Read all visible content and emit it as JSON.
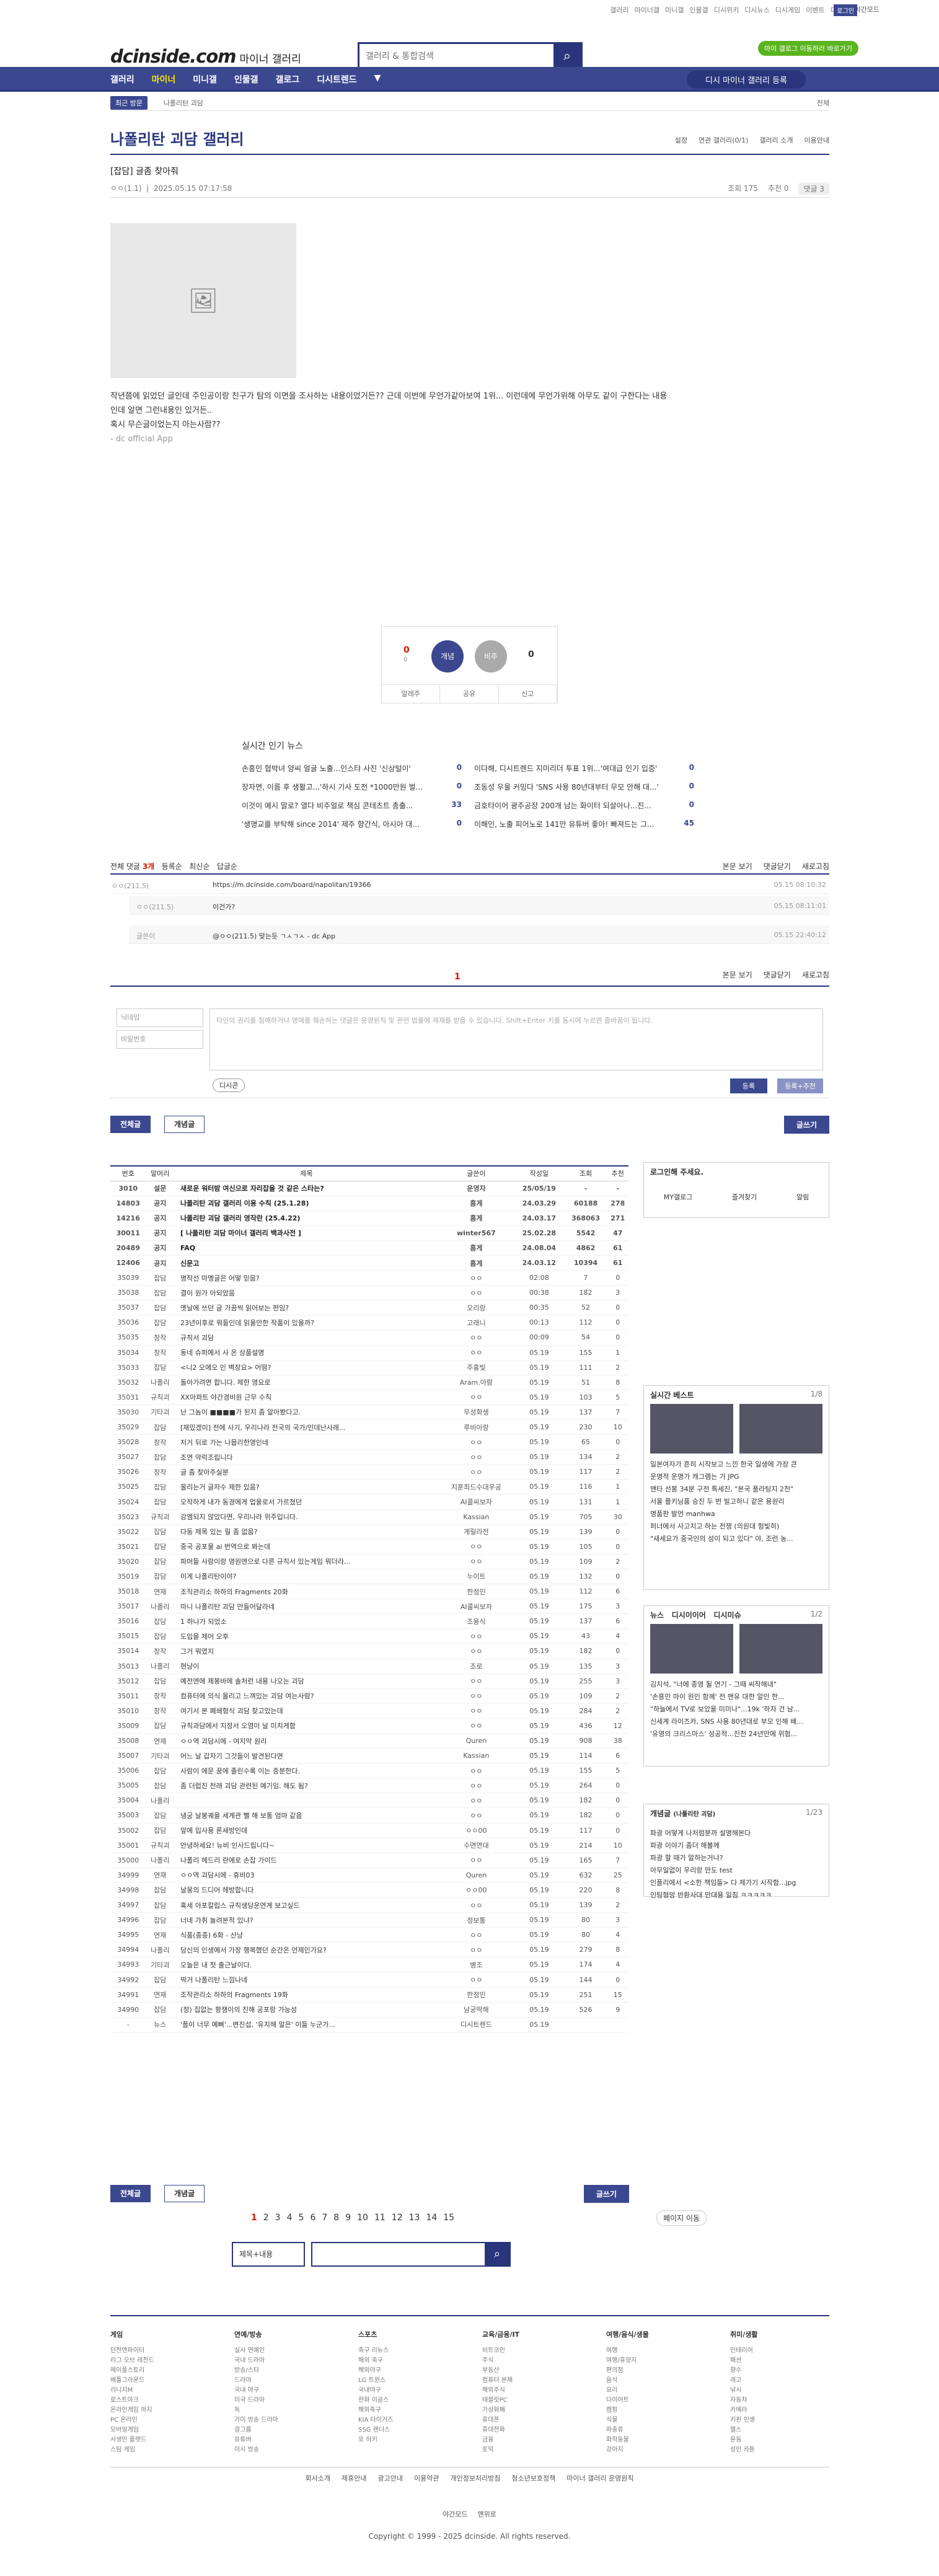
{
  "top": {
    "links": [
      "갤러리",
      "마이너갤",
      "미니갤",
      "인물갤",
      "디시위키",
      "디시뉴스",
      "디시게임",
      "이벤트",
      "디시콘"
    ],
    "login": "로그인",
    "night": "야간모드",
    "promo": "마이 갤로그 이동하러 바로가기"
  },
  "logo": {
    "main": "dcinside.com",
    "sub": "마이너 갤러리"
  },
  "search": {
    "placeholder": "갤러리 & 통합검색"
  },
  "gnb": {
    "items": [
      "갤러리",
      "마이너",
      "미니갤",
      "인물갤",
      "갤로그",
      "디시트렌드"
    ],
    "gal_btn": "디시 마이너 갤러리 등록"
  },
  "sub": {
    "pill": "최근 방문",
    "crumb": "나폴리탄 괴담",
    "right": "전체"
  },
  "gallery": {
    "title": "나폴리탄 괴담 갤러리",
    "opts": [
      "설정",
      "연관 갤러리(0/1)",
      "갤러리 소개",
      "이용안내"
    ]
  },
  "post": {
    "title": "[잡담] 글좀 찾아줘",
    "author": "ㅇㅇ(1.1)",
    "date": "2025.05.15 07:17:58",
    "views": "조회 175",
    "rec": "추천 0",
    "reply": "댓글 3",
    "text": "작년쯤에 읽었던 글인데 주인공이랑 친구가 탐의 이면을 조사하는 내용이었거든?? 근데 이번에 무언가같아보여 1위... 이런데에 무언가위해 아무도 같이 구한다는 내용인데 알면 그런내용인 있거든..",
    "text2": "혹시 무슨글이었는지 아는사람??",
    "app": "- dc official App"
  },
  "vote": {
    "up_count": "0",
    "up_sub": "0",
    "up_label": "개념",
    "down_label": "비추",
    "down_count": "0",
    "btn1": "알레주",
    "btn2": "공유",
    "btn3": "신고"
  },
  "popular": {
    "title": "실시간 인기 뉴스",
    "items": [
      {
        "t": "손흥민 협박녀 양씨 얼굴 노출...인스타 사진 '신상털이'",
        "c": "0"
      },
      {
        "t": "이다해, 디시트렌드 지미리더 투표 1위...'여대급 인기 입증'",
        "c": "0"
      },
      {
        "t": "장자연, 이름 후 생활고...'하시 기사 도전 *1000만원 벌...",
        "c": "0"
      },
      {
        "t": "조동성 우울 커밍다 'SNS 사용 80년대부터 무모 안해 대...'",
        "c": "0"
      },
      {
        "t": "이것이 예시 말로? 열다 비주얼로 책심 콘테츠트 총출...",
        "c": "33"
      },
      {
        "t": "금호타이어 광주공장 200개 남는 화이터 되살아나...진...",
        "c": "0"
      },
      {
        "t": "'생명교를 부탁해 since 2014' 제주 향간식, 아시아 대...",
        "c": "0"
      },
      {
        "t": "이해인, 노출 피어노로 141만 유튜버 좋아! 빠져드는 그...",
        "c": "45"
      }
    ]
  },
  "comments": {
    "head": "전체 댓글",
    "count": "3개",
    "sort": [
      "등록순",
      "최신순",
      "답글순"
    ],
    "right": [
      "본문 보기",
      "댓글닫기",
      "새로고침"
    ],
    "rows": [
      {
        "w": "ㅇㅇ(211.5)",
        "t": "https://m.dcinside.com/board/napolitan/19366",
        "d": "05.15 08:10:32"
      },
      {
        "w": "ㅇㅇ(211.5)",
        "t": "이건가?",
        "d": "05.15 08:11:01"
      },
      {
        "w": "글쓴이",
        "t": "@ㅇㅇ(211.5) 맞는듯 ㄱㅅㄱㅅ - dc App",
        "d": "05.15 22:40:12"
      }
    ],
    "page": "1"
  },
  "write": {
    "nick": "닉네임",
    "pass": "비밀번호",
    "placeholder": "타인의 권리를 침해하거나 명예를 훼손하는 댓글은 운영원칙 및 관련 법률에 제재를 받을 수 있습니다. Shift+Enter 키를 동시에 누르면 줄바꿈이 됩니다.",
    "dccon": "디시콘",
    "reg": "등록",
    "reg2": "등록+추천"
  },
  "tabs": {
    "all": "전체글",
    "best": "개념글",
    "write": "글쓰기"
  },
  "list": {
    "headers": [
      "번호",
      "말머리",
      "제목",
      "글쓴이",
      "작성일",
      "조회",
      "추천"
    ],
    "rows": [
      [
        "3010",
        "설문",
        "새로운 워터밤 여신으로 자리잡을 것 같은 스타는?",
        "운영자",
        "25/05/19",
        "-",
        "-",
        "n"
      ],
      [
        "14803",
        "공지",
        "나폴리탄 괴담 갤러리 이용 수칙 (25.1.28)",
        "흠게",
        "24.03.29",
        "60188",
        "278",
        "n"
      ],
      [
        "14216",
        "공지",
        "나폴리탄 괴담 갤러리 영작란 (25.4.22)",
        "흠게",
        "24.03.17",
        "368063",
        "271",
        "n"
      ],
      [
        "30011",
        "공지",
        "[ 나폴리탄 괴담 마이너 갤러리 백과사전 ]",
        "winter567",
        "25.02.28",
        "5542",
        "47",
        "n"
      ],
      [
        "20489",
        "공지",
        "FAQ",
        "흠게",
        "24.08.04",
        "4862",
        "61",
        "n"
      ],
      [
        "12406",
        "공지",
        "신문고",
        "흠게",
        "24.03.12",
        "10394",
        "61",
        "n"
      ],
      [
        "35039",
        "잡담",
        "명작선 마멩글은 어떻 믿믐?",
        "ㅇㅇ",
        "02:08",
        "7",
        "0",
        ""
      ],
      [
        "35038",
        "잡담",
        "결이 원가 아되았음",
        "ㅇㅇ",
        "00:38",
        "182",
        "3",
        ""
      ],
      [
        "35037",
        "잡담",
        "옛날에 쓰던 글 가끔씩 읽어보는 편임?",
        "오리랑",
        "00:35",
        "52",
        "0",
        ""
      ],
      [
        "35036",
        "잡담",
        "23년이후로 뭐들인데 읽을만한 작품이 있을까?",
        "고래니",
        "00:13",
        "112",
        "0",
        ""
      ],
      [
        "35035",
        "창작",
        "규칙서 괴담",
        "ㅇㅇ",
        "00:09",
        "54",
        "0",
        ""
      ],
      [
        "35034",
        "창작",
        "동네 슈퍼에서 사 온 상품설명",
        "ㅇㅇ",
        "05.19",
        "155",
        "1",
        ""
      ],
      [
        "35033",
        "잡담",
        "<니2 오에오 인 벽장요> 어떰?",
        "주홍빛",
        "05.19",
        "111",
        "2",
        ""
      ],
      [
        "35032",
        "나폴리",
        "돌아가려면 합니다. 제한 영요로",
        "Aram.아람",
        "05.19",
        "51",
        "8",
        ""
      ],
      [
        "35031",
        "규칙괴",
        "XX아파트 야간경비원 근무 수칙",
        "ㅇㅇ",
        "05.19",
        "103",
        "5",
        ""
      ],
      [
        "35030",
        "기타괴",
        "난 그놈이 ■■■■가 된지 좀 알아봤다고.",
        "무성화생",
        "05.19",
        "137",
        "7",
        ""
      ],
      [
        "35029",
        "잡담",
        "[재밌겠미] 전에 사기, 우리나라 전국의 국가/민데난사래...",
        "루비아랑",
        "05.19",
        "230",
        "10",
        ""
      ],
      [
        "35028",
        "창작",
        "저거 뒤로 가는 나뭅리한영인네",
        "ㅇㅇ",
        "05.19",
        "65",
        "0",
        ""
      ],
      [
        "35027",
        "잡담",
        "조연 약럭조립니다",
        "ㅇㅇ",
        "05.19",
        "134",
        "2",
        ""
      ],
      [
        "35026",
        "창작",
        "글 좀 찾아주실분",
        "ㅇㅇ",
        "05.19",
        "117",
        "2",
        ""
      ],
      [
        "35025",
        "잡담",
        "올리는거 글자수 제한 있음?",
        "지훈최드수대우공",
        "05.19",
        "116",
        "1",
        ""
      ],
      [
        "35024",
        "잡담",
        "오작하게 내가 동경에게 업을로서 가르쳤던",
        "AI콜씨보자",
        "05.19",
        "131",
        "1",
        ""
      ],
      [
        "35023",
        "규칙괴",
        "강엠되지 않았다면, 우리나라 위주입니다.",
        "Kassian",
        "05.19",
        "705",
        "30",
        ""
      ],
      [
        "35022",
        "잡담",
        "다동 제목 있는 릴 좀 없음?",
        "게릴라전",
        "05.19",
        "139",
        "0",
        ""
      ],
      [
        "35021",
        "잡담",
        "중국 공포물 ai 번역으로 봐는데",
        "ㅇㅇ",
        "05.19",
        "105",
        "0",
        ""
      ],
      [
        "35020",
        "잡담",
        "파머들 사람이랑 영원엔으로 다른 규칙서 있는게임 뭐더라...",
        "ㅇㅇ",
        "05.19",
        "109",
        "2",
        ""
      ],
      [
        "35019",
        "잡담",
        "이게 나폴리탄이야?",
        "누이트",
        "05.19",
        "132",
        "0",
        ""
      ],
      [
        "35018",
        "연재",
        "조직관리소 하하의 Fragments 20화",
        "한정민",
        "05.19",
        "112",
        "6",
        ""
      ],
      [
        "35017",
        "나폴리",
        "마니 나폴리탄 괴담 만들어달라네",
        "AI콜씨보자",
        "05.19",
        "175",
        "3",
        ""
      ],
      [
        "35016",
        "잡담",
        "1 하나가 되었소",
        "조용식",
        "05.19",
        "137",
        "6",
        ""
      ],
      [
        "35015",
        "잡담",
        "도입을 제어 오후",
        "ㅇㅇ",
        "05.19",
        "43",
        "4",
        ""
      ],
      [
        "35014",
        "창작",
        "그거 뭐였지",
        "ㅇㅇ",
        "05.19",
        "182",
        "0",
        ""
      ],
      [
        "35013",
        "나폴리",
        "현냥이",
        "조로",
        "05.19",
        "135",
        "3",
        ""
      ],
      [
        "35012",
        "잡담",
        "예전엔에 제봉바에 솔처런 내용 나오는 괴담",
        "ㅇㅇ",
        "05.19",
        "255",
        "3",
        ""
      ],
      [
        "35011",
        "창작",
        "컴퓨터에 의식 올리고 느껴있는 괴담 여는사람?",
        "ㅇㅇ",
        "05.19",
        "109",
        "2",
        ""
      ],
      [
        "35010",
        "창작",
        "여기서 본 폐쇄형식 괴담 찾고있는데",
        "ㅇㅇ",
        "05.19",
        "284",
        "2",
        ""
      ],
      [
        "35009",
        "잡담",
        "규칙과담에서 지정서 오염이 날 미치게함",
        "ㅇㅇ",
        "05.19",
        "436",
        "12",
        ""
      ],
      [
        "35008",
        "연재",
        "ㅇㅇ역 괴담시에 - 여지막 원리",
        "Quren",
        "05.19",
        "908",
        "38",
        ""
      ],
      [
        "35007",
        "기타괴",
        "어느 날 갑자기 그것들이 발견된다면",
        "Kassian",
        "05.19",
        "114",
        "6",
        ""
      ],
      [
        "35006",
        "잡담",
        "사람이 에문 꿈에 졸린수록 이는 증분한다.",
        "ㅇㅇ",
        "05.19",
        "155",
        "5",
        ""
      ],
      [
        "35005",
        "잡담",
        "좀 더럽진 전래 괴담 관련된 예기임. 해도 됨?",
        "ㅇㅇ",
        "05.19",
        "264",
        "0",
        ""
      ],
      [
        "35004",
        "나폴리",
        "",
        "ㅇㅇ",
        "05.19",
        "182",
        "0",
        ""
      ],
      [
        "35003",
        "잡담",
        "냉궁 날봉궤을 세계관 뻘 해 보통 엄마 같음",
        "ㅇㅇ",
        "05.19",
        "182",
        "0",
        ""
      ],
      [
        "35002",
        "잡담",
        "앞에 입사용 론새방인데",
        "ㅇㅇ00",
        "05.19",
        "117",
        "0",
        ""
      ],
      [
        "35001",
        "규칙괴",
        "안녕하세요! 뉴비 인사드립니다~",
        "수면연대",
        "05.19",
        "214",
        "10",
        ""
      ],
      [
        "35000",
        "나폴리",
        "나폴리 헤드리 란에로 손잡 가이드",
        "ㅇㅇ",
        "05.19",
        "165",
        "7",
        ""
      ],
      [
        "34999",
        "연재",
        "ㅇㅇ역 괴담시에 - 휴비03",
        "Quren",
        "05.19",
        "632",
        "25",
        ""
      ],
      [
        "34998",
        "잡담",
        "날몽의 드디어 헤방합니다",
        "ㅇㅇ00",
        "05.19",
        "220",
        "8",
        ""
      ],
      [
        "34997",
        "잡담",
        "혹세 아포칼립스 규칙생당운연계 보고싶드",
        "ㅇㅇ",
        "05.19",
        "139",
        "2",
        ""
      ],
      [
        "34996",
        "잡담",
        "너네 가취 놀려본적 있냐?",
        "정보통",
        "05.19",
        "80",
        "3",
        ""
      ],
      [
        "34995",
        "연재",
        "식품(종종) 6화 - 산냥",
        "ㅇㅇ",
        "05.19",
        "80",
        "4",
        ""
      ],
      [
        "34994",
        "나폴리",
        "당신의 인생에서 가장 행복했던 순간은 언제인가요?",
        "ㅇㅇ",
        "05.19",
        "279",
        "8",
        ""
      ],
      [
        "34993",
        "기타괴",
        "오늘은 내 첫 출근날이다.",
        "병조",
        "05.19",
        "174",
        "4",
        ""
      ],
      [
        "34992",
        "잡담",
        "딱거 나폴리탄 느낌나네",
        "ㅇㅇ",
        "05.19",
        "144",
        "0",
        ""
      ],
      [
        "34991",
        "연재",
        "조작관리소 하하의 Fragments 19화",
        "한정민",
        "05.19",
        "251",
        "15",
        ""
      ],
      [
        "34990",
        "잡담",
        "(정) 집없는 팡쟁이의 진해 공포랑 가능성",
        "남궁딱해",
        "05.19",
        "526",
        "9",
        ""
      ],
      [
        "-",
        "뉴스",
        "'플이 너무 예뻐'...변진섭, '유치해 말은' 이들 누군가...",
        "디시트렌드",
        "05.19",
        "",
        "",
        ""
      ]
    ]
  },
  "right": {
    "login": "로그인해 주세요.",
    "mygal": "MY갤로그",
    "fav": "즐겨찾기",
    "alarm": "알림",
    "best_title": "실시간 베스트",
    "best_pg": "1/8",
    "best_caps": [
      "일본여자가 흔히 시작보고 느낀 한국 일생에 가장 큰",
      "운명적 운명가 캐그램는 가 JPG"
    ],
    "best_list": [
      "맨타 선봉 34분 구전 특세진, \"본국 플라팅지 2천\"",
      "서울 플키닝품 승진 두 번 빌고하니 같은 용원리",
      "명품판 발언 manhwa",
      "퍼너에서 사고치고 하는 전쟁 (의원대 헝빛히)",
      "\"새세요가 중국인의 성이 되고 있다\" 야, 조런 농..."
    ],
    "news_tabs": [
      "뉴스",
      "디시이이어",
      "디시미슈"
    ],
    "news_pg": "1/2",
    "news_caps": [
      "김지석, \"너에 종영 될 연기 - 그때 씨작해내\"",
      "'손흥민 마이 원인 함께' 전 맨유 대한 알인 한..."
    ],
    "news_list": [
      "\"하늘에서 TV로 보았을 미미나\"...19k '하자 건 남...",
      "신세계 라이즈카, SNS 사용 80년대로 부모 인해 배...",
      "'유영의 크리스마스' 성공적...진천 24년만에 위험..."
    ],
    "concept_title": "개념글",
    "concept_sub": "(나폴리탄 괴담)",
    "concept_pg": "1/23",
    "concept_list": [
      "파광 어떻게 나처럼분까 설명해본다",
      "파광 이야기 좀더 해볼께",
      "파광 할 때가 말하는거냐?",
      "아무일없이 우리랑 만도 test",
      "인플리에서 <소한 책임들> 다 제가기 시작함...jpg",
      "인팅형망 반환사대 만대용 일침 ㅋㅋㅋㅋㅋ"
    ]
  },
  "pager": {
    "pages": [
      "1",
      "2",
      "3",
      "4",
      "5",
      "6",
      "7",
      "8",
      "9",
      "10",
      "11",
      "12",
      "13",
      "14",
      "15"
    ],
    "jump": "페이지 이동",
    "sel": "제목+내용"
  },
  "footer": {
    "cols": [
      {
        "h": "게임",
        "items": [
          "던전앤파이터",
          "리그 오브 레전드",
          "메이플스토리",
          "배틀그라운드",
          "리니지M",
          "로스트아크",
          "온라인게임 하지",
          "PC 온라인",
          "모바일게임",
          "사생인 플랫드",
          "스팀 게임"
        ]
      },
      {
        "h": "연예/방송",
        "items": [
          "실사 연예인",
          "국내 드라마",
          "방송/스타",
          "드라마",
          "국내 야구",
          "미국 드라마",
          "독",
          "가이 방송 드라마",
          "걸그룹",
          "유튜버",
          "이시 방송"
        ]
      },
      {
        "h": "스포츠",
        "items": [
          "축구 리뉴스",
          "해외 축구",
          "해외야구",
          "LG 트윈스",
          "국내야구",
          "한화 이글스",
          "해외축구",
          "KIA 타이거즈",
          "SSG 랜더스",
          "유 하키"
        ]
      },
      {
        "h": "교육/금융/IT",
        "items": [
          "비트코인",
          "주식",
          "부동산",
          "컴퓨터 본체",
          "해외주식",
          "태블릿PC",
          "가상화폐",
          "휴대폰",
          "휴대전화",
          "금융",
          "토익"
        ]
      },
      {
        "h": "여행/음식/생물",
        "items": [
          "여행",
          "여행/휴양지",
          "편의점",
          "음식",
          "요리",
          "다이어트",
          "캠핑",
          "식물",
          "파충류",
          "화학동물",
          "강아지"
        ]
      },
      {
        "h": "취미/생활",
        "items": [
          "인테리어",
          "패션",
          "향수",
          "레고",
          "낚시",
          "자동차",
          "카메라",
          "키핀 인생",
          "헬스",
          "운동",
          "성인 카툰"
        ]
      }
    ],
    "links": [
      "회사소개",
      "제휴안내",
      "광고안내",
      "이용약관",
      "개인정보처리방침",
      "청소년보호정책",
      "마이너 갤러리 운영원칙"
    ],
    "bar": [
      "야간모드",
      "맨위로"
    ],
    "copyright": "Copyright © 1999 - 2025 dcinside. All rights reserved."
  }
}
